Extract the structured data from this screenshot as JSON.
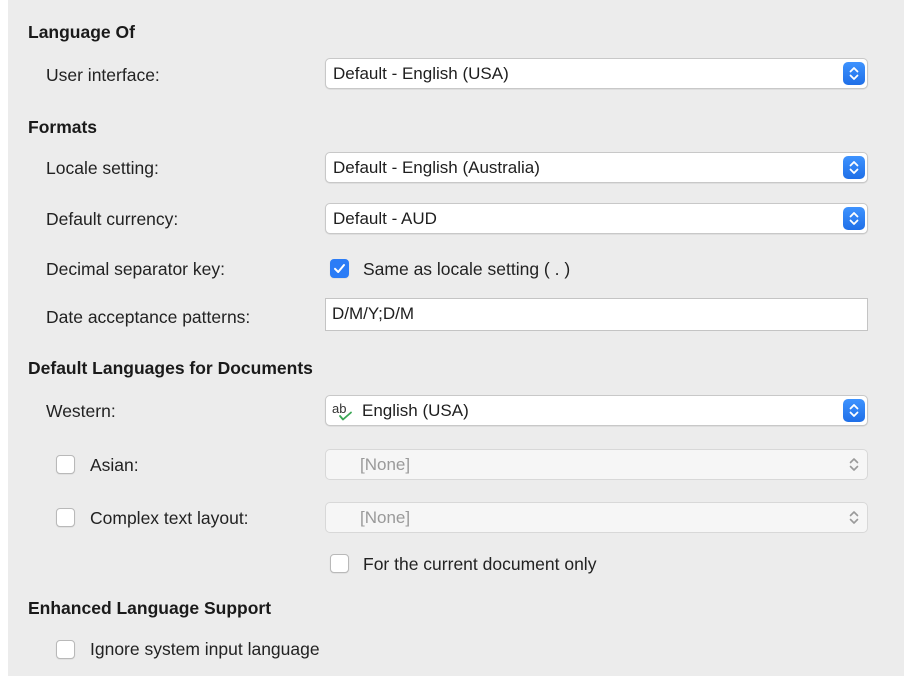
{
  "language_of": {
    "title": "Language Of",
    "user_interface_label": "User interface:",
    "user_interface_value": "Default - English (USA)"
  },
  "formats": {
    "title": "Formats",
    "locale_label": "Locale setting:",
    "locale_value": "Default - English (Australia)",
    "currency_label": "Default currency:",
    "currency_value": "Default - AUD",
    "decimal_label": "Decimal separator key:",
    "decimal_checkbox_label": "Same as locale setting ( . )",
    "decimal_checked": true,
    "date_label": "Date acceptance patterns:",
    "date_value": "D/M/Y;D/M"
  },
  "default_languages": {
    "title": "Default Languages for Documents",
    "western_label": "Western:",
    "western_value": "English (USA)",
    "western_icon": "spellcheck-icon",
    "asian_label": "Asian:",
    "asian_value": "[None]",
    "asian_checked": false,
    "ctl_label": "Complex text layout:",
    "ctl_value": "[None]",
    "ctl_checked": false,
    "current_doc_label": "For the current document only",
    "current_doc_checked": false
  },
  "enhanced": {
    "title": "Enhanced Language Support",
    "ignore_input_label": "Ignore system input language",
    "ignore_input_checked": false
  },
  "colors": {
    "accent": "#2b7cf6",
    "panel_bg": "#ececec"
  }
}
